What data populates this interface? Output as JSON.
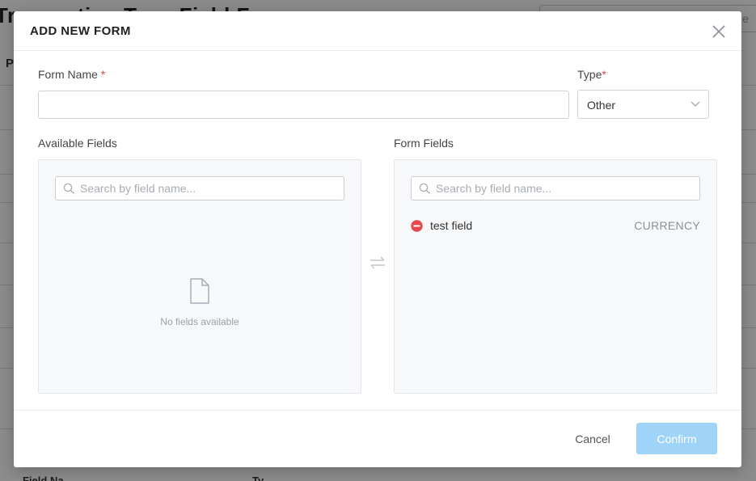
{
  "background": {
    "title": "Transaction Type Field Form",
    "section_initial": "P",
    "search_tail": "age",
    "bottom_labels": [
      "Field Na",
      "Ty"
    ]
  },
  "modal": {
    "title": "ADD NEW FORM",
    "close_icon": "close-icon",
    "form_name": {
      "label": "Form Name",
      "required_mark": "*",
      "value": "",
      "placeholder": ""
    },
    "type": {
      "label": "Type",
      "required_mark": "*",
      "selected": "Other"
    },
    "available_fields": {
      "label": "Available Fields",
      "search_placeholder": "Search by field name...",
      "empty_text": "No fields available",
      "items": []
    },
    "form_fields": {
      "label": "Form Fields",
      "search_placeholder": "Search by field name...",
      "items": [
        {
          "name": "test field",
          "type": "CURRENCY"
        }
      ]
    },
    "footer": {
      "cancel_label": "Cancel",
      "confirm_label": "Confirm"
    }
  },
  "colors": {
    "required": "#e0443e",
    "confirm_disabled": "#9fd3f7",
    "remove_icon": "#e5484d"
  }
}
